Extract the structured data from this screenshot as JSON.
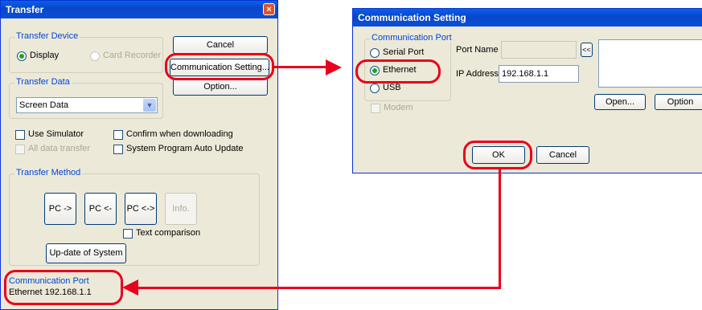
{
  "transfer": {
    "title": "Transfer",
    "close_glyph": "×",
    "transfer_device": {
      "label": "Transfer Device",
      "display": "Display",
      "card_recorder": "Card Recorder",
      "selected": "Display"
    },
    "cancel_label": "Cancel",
    "comm_setting_label": "Communication Setting...",
    "option_label": "Option...",
    "transfer_data": {
      "label": "Transfer Data",
      "value": "Screen Data"
    },
    "use_simulator": "Use Simulator",
    "confirm_downloading": "Confirm when downloading",
    "all_data_transfer": "All data transfer",
    "system_program_update": "System Program Auto Update",
    "transfer_method": {
      "label": "Transfer Method",
      "pc_to": "PC ->",
      "pc_from": "PC <-",
      "pc_both": "PC <->",
      "info": "Info.",
      "text_comparison": "Text comparison",
      "update_system": "Up-date of System"
    },
    "communication_port": {
      "label": "Communication Port",
      "value": "Ethernet 192.168.1.1"
    }
  },
  "comm_dialog": {
    "title": "Communication Setting",
    "port_group_label": "Communication Port",
    "serial_port": "Serial Port",
    "ethernet": "Ethernet",
    "usb": "USB",
    "selected": "Ethernet",
    "modem": "Modem",
    "port_name_label": "Port Name",
    "port_name_value": "",
    "expand_glyph": "<<",
    "ip_address_label": "IP Address",
    "ip_address_value": "192.168.1.1",
    "open_label": "Open...",
    "option_label": "Option",
    "ok_label": "OK",
    "cancel_label": "Cancel"
  },
  "colors": {
    "annotation": "#e8001c",
    "titlebar": "#0a5fe6",
    "group_label": "#0046d5"
  }
}
